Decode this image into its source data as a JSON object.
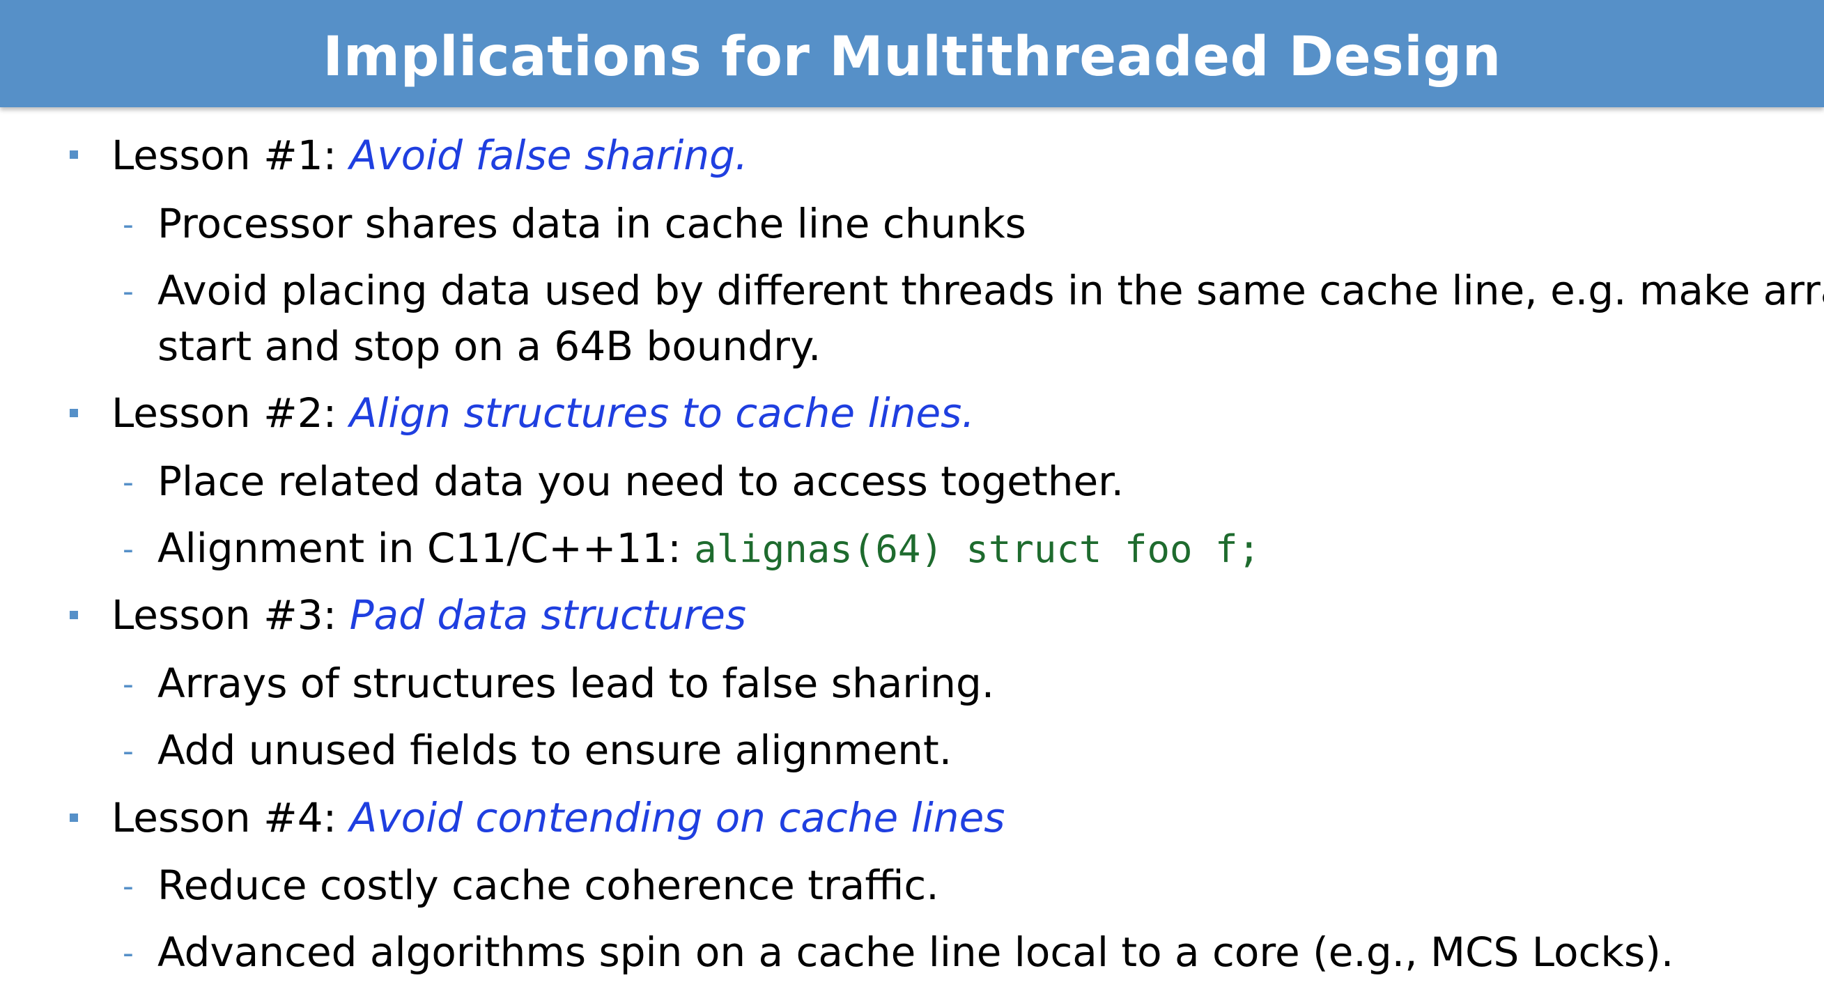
{
  "title": "Implications for Multithreaded Design",
  "colors": {
    "header_bg": "#5690c8",
    "header_text": "#ffffff",
    "emphasis": "#1f3fe0",
    "code": "#1e6b2e",
    "bullet": "#5690c8"
  },
  "lessons": [
    {
      "label": "Lesson #1: ",
      "emphasis": "Avoid false sharing.",
      "points": [
        "Processor shares data in cache line chunks",
        "Avoid placing data used by different threads in the same cache line, e.g.  make arrays",
        "start and stop on a 64B boundry."
      ]
    },
    {
      "label": "Lesson #2: ",
      "emphasis": "Align structures to cache lines.",
      "points": [
        "Place related data you need to access together.",
        "Alignment in C11/C++11: "
      ],
      "code": "alignas(64) struct foo f;"
    },
    {
      "label": "Lesson #3: ",
      "emphasis": "Pad data structures",
      "points": [
        "Arrays of structures lead to false sharing.",
        "Add unused fields to ensure alignment."
      ]
    },
    {
      "label": "Lesson #4: ",
      "emphasis": "Avoid contending on cache lines",
      "points": [
        "Reduce costly cache coherence traffic.",
        "Advanced algorithms spin on a cache line local to a core (e.g., MCS Locks)."
      ]
    }
  ]
}
